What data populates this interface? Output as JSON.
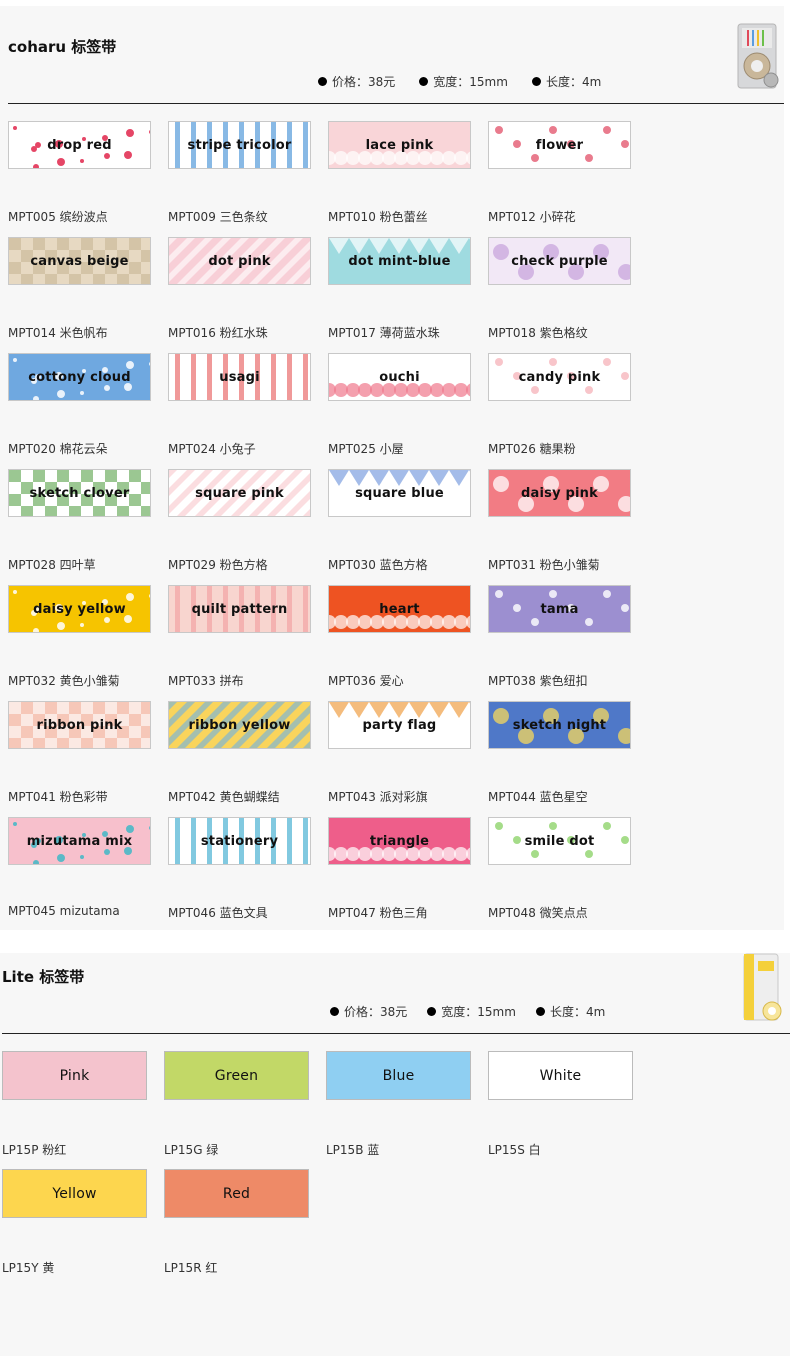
{
  "sections": [
    {
      "title": "coharu 标签带",
      "specs": [
        "价格：38元",
        "宽度：15mm",
        "长度：4m"
      ],
      "items": [
        {
          "label": "drop red",
          "name": "MPT005 缤纷波点",
          "bg": "#ffffff",
          "fg": "#e0264b"
        },
        {
          "label": "stripe tricolor",
          "name": "MPT009 三色条纹",
          "bg": "#ffffff",
          "fg": "#6aa7de"
        },
        {
          "label": "lace pink",
          "name": "MPT010 粉色蕾丝",
          "bg": "#f9d5d8",
          "fg": "#ffffff"
        },
        {
          "label": "flower",
          "name": "MPT012 小碎花",
          "bg": "#ffffff",
          "fg": "#e35a70"
        },
        {
          "label": "canvas beige",
          "name": "MPT014 米色帆布",
          "bg": "#e7d9c2",
          "fg": "#c8b595"
        },
        {
          "label": "dot pink",
          "name": "MPT016 粉红水珠",
          "bg": "#f8cfd7",
          "fg": "#ffffff"
        },
        {
          "label": "dot mint-blue",
          "name": "MPT017 薄荷蓝水珠",
          "bg": "#9fdbe0",
          "fg": "#ffffff"
        },
        {
          "label": "check purple",
          "name": "MPT018 紫色格纹",
          "bg": "#f2e8f6",
          "fg": "#c8a6dc"
        },
        {
          "label": "cottony cloud",
          "name": "MPT020 棉花云朵",
          "bg": "#6fa8e0",
          "fg": "#ffffff"
        },
        {
          "label": "usagi",
          "name": "MPT024 小兔子",
          "bg": "#ffffff",
          "fg": "#ec7f7f"
        },
        {
          "label": "ouchi",
          "name": "MPT025 小屋",
          "bg": "#ffffff",
          "fg": "#f0788c"
        },
        {
          "label": "candy pink",
          "name": "MPT026 糖果粉",
          "bg": "#ffffff",
          "fg": "#f6b7bd"
        },
        {
          "label": "sketch clover",
          "name": "MPT028 四叶草",
          "bg": "#ffffff",
          "fg": "#58a24a"
        },
        {
          "label": "square pink",
          "name": "MPT029 粉色方格",
          "bg": "#ffffff",
          "fg": "#f8c6cc"
        },
        {
          "label": "square blue",
          "name": "MPT030 蓝色方格",
          "bg": "#ffffff",
          "fg": "#7ea0df"
        },
        {
          "label": "daisy pink",
          "name": "MPT031 粉色小雏菊",
          "bg": "#f27c84",
          "fg": "#ffffff"
        },
        {
          "label": "daisy yellow",
          "name": "MPT032 黄色小雏菊",
          "bg": "#f6c400",
          "fg": "#ffffff"
        },
        {
          "label": "quilt pattern",
          "name": "MPT033 拼布",
          "bg": "#f8d5cf",
          "fg": "#f3a9a9"
        },
        {
          "label": "heart",
          "name": "MPT036 爱心",
          "bg": "#ee5322",
          "fg": "#ffffff"
        },
        {
          "label": "tama",
          "name": "MPT038 紫色纽扣",
          "bg": "#9c8fd0",
          "fg": "#ffffff"
        },
        {
          "label": "ribbon pink",
          "name": "MPT041 粉色彩带",
          "bg": "#f6c7b8",
          "fg": "#ffffff"
        },
        {
          "label": "ribbon yellow",
          "name": "MPT042 黄色蝴蝶结",
          "bg": "#f9d45c",
          "fg": "#6ab0e6"
        },
        {
          "label": "party flag",
          "name": "MPT043 派对彩旗",
          "bg": "#ffffff",
          "fg": "#f0a046"
        },
        {
          "label": "sketch night",
          "name": "MPT044 蓝色星空",
          "bg": "#4f78c8",
          "fg": "#f6d85c"
        },
        {
          "label": "mizutama mix",
          "name": "MPT045 mizutama",
          "bg": "#f7c0cc",
          "fg": "#3fb7c6"
        },
        {
          "label": "stationery",
          "name": "MPT046 蓝色文具",
          "bg": "#ffffff",
          "fg": "#62bcd8"
        },
        {
          "label": "triangle",
          "name": "MPT047 粉色三角",
          "bg": "#ee5e8a",
          "fg": "#ffffff"
        },
        {
          "label": "smile dot",
          "name": "MPT048 微笑点点",
          "bg": "#ffffff",
          "fg": "#8fd36b"
        }
      ]
    },
    {
      "title": "Lite 标签带",
      "specs": [
        "价格：38元",
        "宽度：15mm",
        "长度：4m"
      ],
      "items": [
        {
          "label": "Pink",
          "name": "LP15P 粉红",
          "bg": "#f4c3cd"
        },
        {
          "label": "Green",
          "name": "LP15G 绿",
          "bg": "#c2d867"
        },
        {
          "label": "Blue",
          "name": "LP15B 蓝",
          "bg": "#8fcff2"
        },
        {
          "label": "White",
          "name": "LP15S 白",
          "bg": "#ffffff"
        },
        {
          "label": "Yellow",
          "name": "LP15Y 黄",
          "bg": "#fdd64e"
        },
        {
          "label": "Red",
          "name": "LP15R 红",
          "bg": "#ee8a67"
        }
      ]
    }
  ]
}
